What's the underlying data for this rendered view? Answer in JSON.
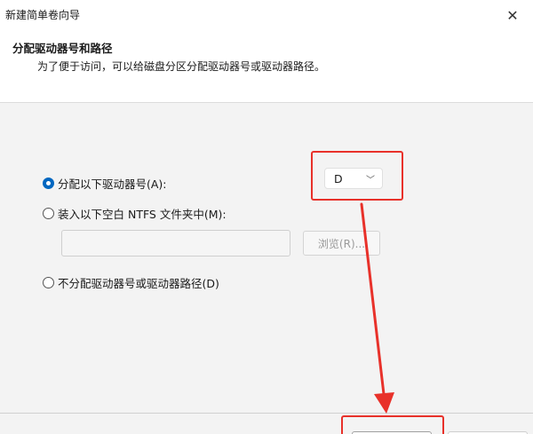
{
  "window": {
    "title": "新建简单卷向导",
    "close_glyph": "✕"
  },
  "header": {
    "title": "分配驱动器号和路径",
    "description": "为了便于访问，可以给磁盘分区分配驱动器号或驱动器路径。"
  },
  "options": {
    "assign_letter_label": "分配以下驱动器号(A):",
    "mount_folder_label": "装入以下空白 NTFS 文件夹中(M):",
    "no_assign_label": "不分配驱动器号或驱动器路径(D)",
    "selected": "assign_letter"
  },
  "drive_letter": {
    "value": "D",
    "chevron": "﹀"
  },
  "folder": {
    "path_value": "",
    "browse_label": "浏览(R)..."
  },
  "annotations": {
    "highlight_color": "#e8312a"
  },
  "colors": {
    "accent": "#0067c0",
    "annotation_red": "#e8312a"
  },
  "icons": [
    "close-icon",
    "radio-selected-icon",
    "radio-unselected-icon",
    "chevron-down-icon",
    "arrow-annotation-icon"
  ]
}
